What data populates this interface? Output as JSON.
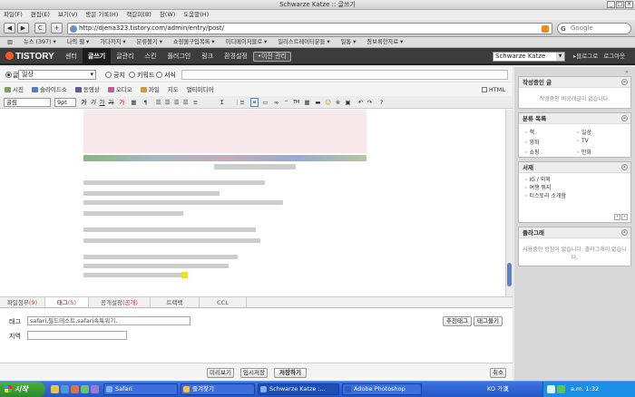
{
  "window": {
    "title": "Schwarze Katze :: 글쓰기"
  },
  "menubar": [
    "파일(F)",
    "편집(E)",
    "보기(V)",
    "방문 기록(H)",
    "책갈피(B)",
    "창(W)",
    "도움말(H)"
  ],
  "toolbar": {
    "back": "◀",
    "forward": "▶",
    "reload": "C",
    "add": "+",
    "url": "http://djena323.tistory.com/admin/entry/post/",
    "search_placeholder": "Google"
  },
  "bookmarks": [
    "뉴스 (397) ▾",
    "나의 웹 ▾",
    "가다까지 ▾",
    "분류몰기 ▾",
    "쇼핑몰구입목록 ▾",
    "미디메이저블로 ▾",
    "일러스트레이터분들 ▾",
    "일통 ▾",
    "참보록한자료 ▾"
  ],
  "tistory_nav": {
    "logo": "TISTORY",
    "menu": [
      "센터",
      "글쓰기",
      "글관리",
      "스킨",
      "플러그인",
      "링크",
      "환경설정"
    ],
    "old_manager": "•이전 관리",
    "blog_select": "Schwarze Katze",
    "links": [
      "▸블로그로",
      "로그아웃"
    ]
  },
  "category": {
    "selected": "일상",
    "options": [
      "공지",
      "키워드",
      "서식"
    ]
  },
  "attach_bar": {
    "toggle": "시진",
    "items": [
      "슬라이드쇼",
      "동영상",
      "오디오",
      "파일",
      "지도",
      "멀티미디어"
    ],
    "html_label": "HTML"
  },
  "format_bar": {
    "font": "굴림",
    "size": "9pt",
    "buttons": [
      "가",
      "가",
      "가",
      "가",
      "가"
    ]
  },
  "bottom_tabs": [
    {
      "label": "파일첨부",
      "count": "(9)"
    },
    {
      "label": "태그",
      "count": "(5)"
    },
    {
      "label": "공개설정",
      "count": "(공개)"
    },
    {
      "label": "트랙백",
      "count": ""
    },
    {
      "label": "CCL",
      "count": ""
    }
  ],
  "tags": {
    "label": "태그",
    "value": "safari,필드테스트,safari속툭워기,",
    "recommend_button": "추천태그",
    "manage_button": "태그불기"
  },
  "location": {
    "label": "지역",
    "value": ""
  },
  "actions": {
    "preview": "미리보기",
    "temp_save": "임시저장",
    "save": "저장하기",
    "cancel": "취소"
  },
  "sidebar": {
    "draft": {
      "title": "작성중인 글",
      "empty": "작성중인 비공개글이 없습니다."
    },
    "categories": {
      "title": "분류 목록",
      "items": [
        "책",
        "일상",
        "영화",
        "TV",
        "쇼핑",
        "만화"
      ]
    },
    "series": {
      "title": "서재",
      "items": [
        "IG / 외외",
        "여행 뭐지",
        "티스토리 소개함"
      ]
    },
    "guestbook": {
      "title": "졸라그래",
      "empty": "사용중인 방침이 없습니다. 졸라그래이 없습니다."
    }
  },
  "taskbar": {
    "start": "시작",
    "windows": [
      {
        "label": "Safari",
        "color": "#7fb0ff"
      },
      {
        "label": "즐겨찾기",
        "color": "#f2c14e"
      },
      {
        "label": "Schwarze Katze :...",
        "color": "#7fb0ff"
      },
      {
        "label": "Adobe Photoshop",
        "color": "#2b5fb8"
      }
    ],
    "tray": {
      "lang": "KO 가漢 ",
      "time": "a.m. 1:32"
    }
  }
}
